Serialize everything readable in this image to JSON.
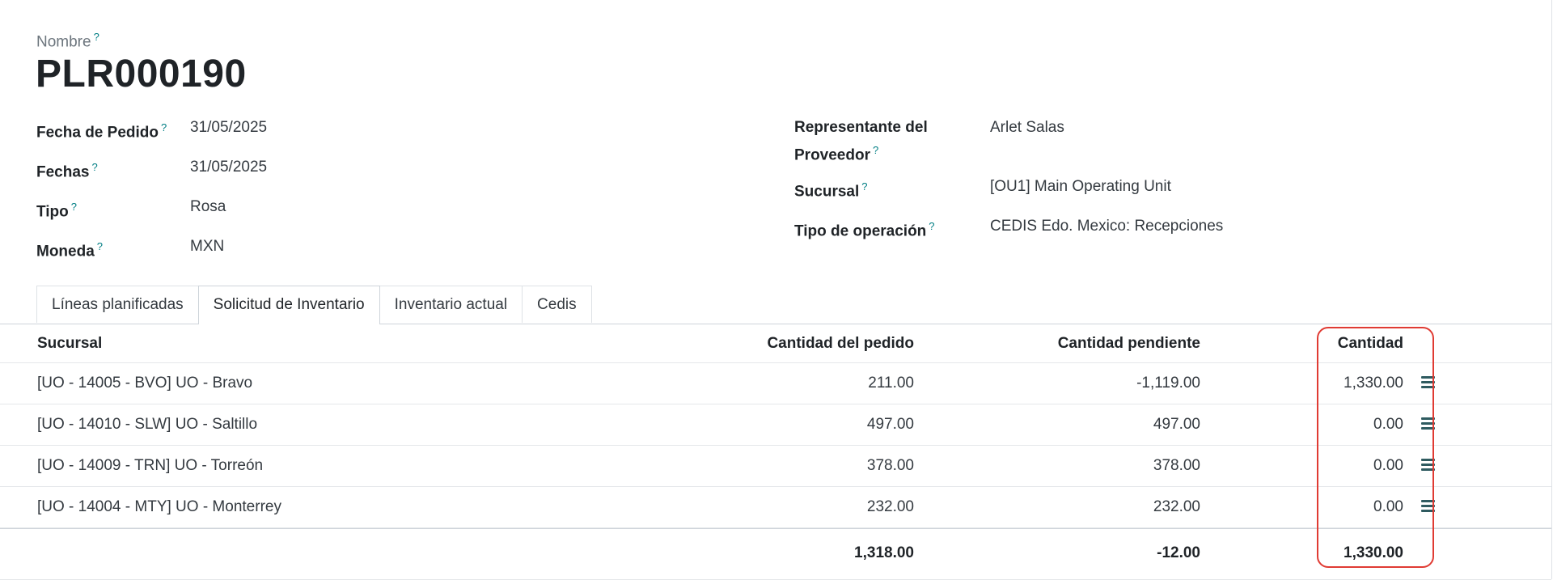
{
  "record": {
    "name_label": "Nombre",
    "name": "PLR000190"
  },
  "fields_left": [
    {
      "label": "Fecha de Pedido",
      "value": "31/05/2025"
    },
    {
      "label": "Fechas",
      "value": "31/05/2025"
    },
    {
      "label": "Tipo",
      "value": "Rosa"
    },
    {
      "label": "Moneda",
      "value": "MXN"
    }
  ],
  "fields_right": [
    {
      "label_line1": "Representante del",
      "label_line2": "Proveedor",
      "value": "Arlet Salas"
    },
    {
      "label": "Sucursal",
      "value": "[OU1] Main Operating Unit"
    },
    {
      "label": "Tipo de operación",
      "value": "CEDIS Edo. Mexico: Recepciones"
    }
  ],
  "help_mark": "?",
  "tabs": [
    {
      "label": "Líneas planificadas",
      "active": false
    },
    {
      "label": "Solicitud de Inventario",
      "active": true
    },
    {
      "label": "Inventario actual",
      "active": false
    },
    {
      "label": "Cedis",
      "active": false
    }
  ],
  "table": {
    "columns": {
      "sucursal": "Sucursal",
      "cantidad_pedido": "Cantidad del pedido",
      "cantidad_pendiente": "Cantidad pendiente",
      "cantidad": "Cantidad"
    },
    "rows": [
      {
        "sucursal": "[UO - 14005 - BVO] UO - Bravo",
        "cantidad_pedido": "211.00",
        "cantidad_pendiente": "-1,119.00",
        "cantidad": "1,330.00"
      },
      {
        "sucursal": "[UO - 14010 - SLW] UO - Saltillo",
        "cantidad_pedido": "497.00",
        "cantidad_pendiente": "497.00",
        "cantidad": "0.00"
      },
      {
        "sucursal": "[UO - 14009 - TRN] UO - Torreón",
        "cantidad_pedido": "378.00",
        "cantidad_pendiente": "378.00",
        "cantidad": "0.00"
      },
      {
        "sucursal": "[UO - 14004 - MTY] UO - Monterrey",
        "cantidad_pedido": "232.00",
        "cantidad_pendiente": "232.00",
        "cantidad": "0.00"
      }
    ],
    "totals": {
      "cantidad_pedido": "1,318.00",
      "cantidad_pendiente": "-12.00",
      "cantidad": "1,330.00"
    }
  },
  "colors": {
    "accent": "#017e84",
    "highlight": "#e03b33",
    "handle": "#2f5b60"
  }
}
